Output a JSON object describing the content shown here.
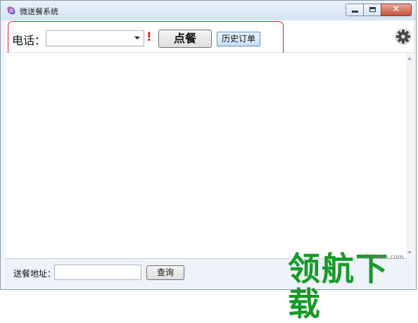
{
  "window": {
    "title": "微送餐系统"
  },
  "toolbar": {
    "phone_label": "电话：",
    "phone_value": "",
    "required_mark": "!",
    "order_label": "点餐",
    "history_label": "历史订单"
  },
  "footer": {
    "address_label": "送餐地址：",
    "address_value": "",
    "query_label": "查询"
  },
  "watermark": {
    "text": "领航下载",
    "url": "lhdown.com"
  },
  "colors": {
    "highlight": "#d9262f",
    "required": "#e02222",
    "watermark": "#179a28"
  },
  "icons": {
    "app": "app-logo-icon",
    "settings": "gear-icon"
  }
}
